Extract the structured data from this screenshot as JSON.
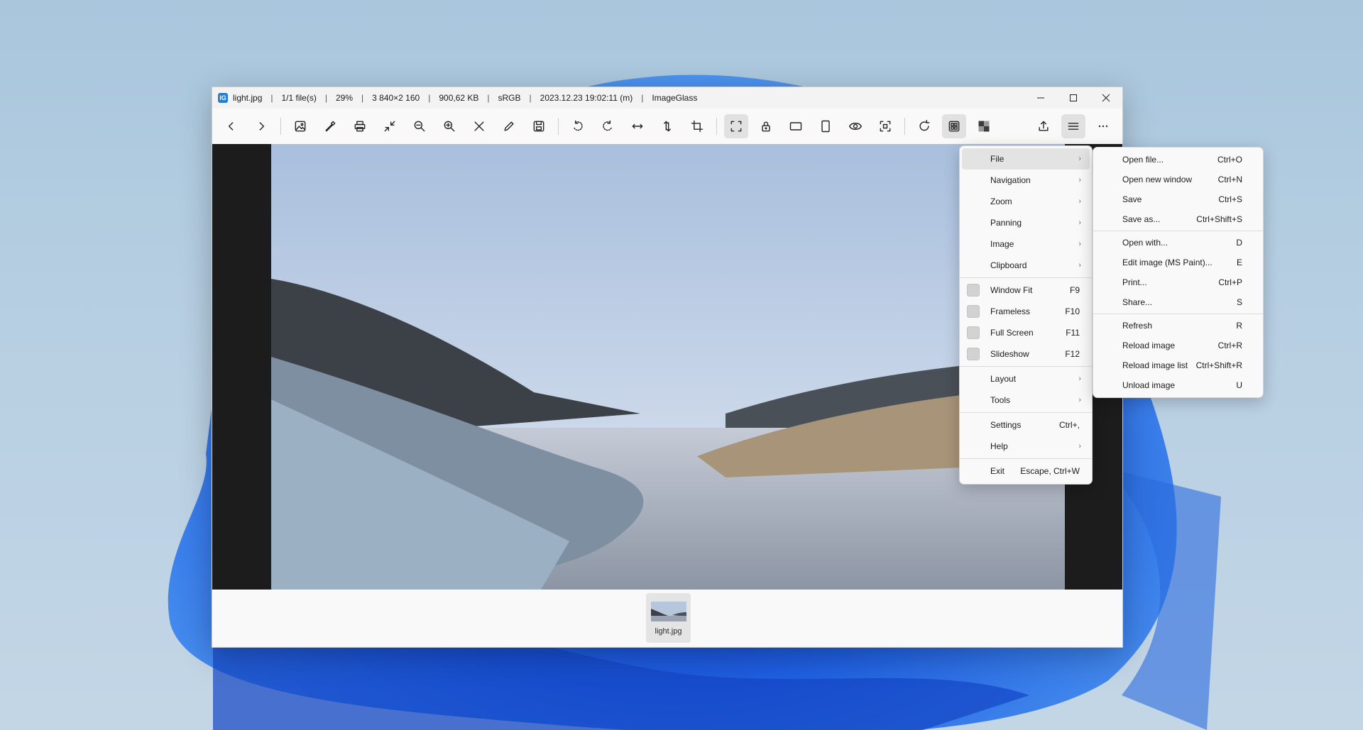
{
  "titlebar": {
    "filename": "light.jpg",
    "file_count": "1/1 file(s)",
    "zoom": "29%",
    "dimensions": "3 840×2 160",
    "filesize": "900,62 KB",
    "color_profile": "sRGB",
    "date": "2023.12.23 19:02:11 (m)",
    "app_name": "ImageGlass",
    "logo_letter": "IG"
  },
  "toolbar": {
    "buttons": [
      {
        "name": "previous-image",
        "icon": "chevron-left-icon"
      },
      {
        "name": "next-image",
        "icon": "chevron-right-icon"
      },
      {
        "name": "open-file",
        "icon": "image-icon"
      },
      {
        "name": "color-picker",
        "icon": "eyedropper-icon"
      },
      {
        "name": "print",
        "icon": "printer-icon"
      },
      {
        "name": "auto-zoom",
        "icon": "shrink-icon"
      },
      {
        "name": "zoom-out",
        "icon": "zoom-out-icon"
      },
      {
        "name": "zoom-in",
        "icon": "zoom-in-icon"
      },
      {
        "name": "clear",
        "icon": "close-icon"
      },
      {
        "name": "edit",
        "icon": "pencil-icon"
      },
      {
        "name": "save",
        "icon": "save-icon"
      },
      {
        "name": "rotate-left",
        "icon": "rotate-left-icon"
      },
      {
        "name": "rotate-right",
        "icon": "rotate-right-icon"
      },
      {
        "name": "flip-horizontal",
        "icon": "flip-horizontal-icon"
      },
      {
        "name": "flip-vertical",
        "icon": "flip-vertical-icon"
      },
      {
        "name": "crop",
        "icon": "crop-icon"
      },
      {
        "name": "window-fit",
        "icon": "window-fit-icon"
      },
      {
        "name": "lock-zoom",
        "icon": "lock-icon"
      },
      {
        "name": "scale-to-width",
        "icon": "landscape-icon"
      },
      {
        "name": "scale-to-height",
        "icon": "portrait-icon"
      },
      {
        "name": "preview",
        "icon": "eye-icon"
      },
      {
        "name": "full-screen",
        "icon": "fullscreen-icon"
      },
      {
        "name": "refresh",
        "icon": "refresh-icon"
      },
      {
        "name": "gallery",
        "icon": "gallery-icon"
      },
      {
        "name": "checkerboard",
        "icon": "checkerboard-icon"
      },
      {
        "name": "share",
        "icon": "upload-icon"
      },
      {
        "name": "main-menu",
        "icon": "hamburger-icon"
      },
      {
        "name": "more",
        "icon": "more-icon"
      }
    ]
  },
  "thumbnail": {
    "label": "light.jpg"
  },
  "main_menu": {
    "items": [
      {
        "label": "File",
        "submenu": true
      },
      {
        "label": "Navigation",
        "submenu": true
      },
      {
        "label": "Zoom",
        "submenu": true
      },
      {
        "label": "Panning",
        "submenu": true
      },
      {
        "label": "Image",
        "submenu": true
      },
      {
        "label": "Clipboard",
        "submenu": true
      },
      {
        "label": "Window Fit",
        "key": "F9"
      },
      {
        "label": "Frameless",
        "key": "F10"
      },
      {
        "label": "Full Screen",
        "key": "F11"
      },
      {
        "label": "Slideshow",
        "key": "F12"
      },
      {
        "label": "Layout",
        "submenu": true
      },
      {
        "label": "Tools",
        "submenu": true
      },
      {
        "label": "Settings",
        "key": "Ctrl+,"
      },
      {
        "label": "Help",
        "submenu": true
      },
      {
        "label": "Exit",
        "key": "Escape, Ctrl+W"
      }
    ],
    "arrow": "›"
  },
  "file_submenu": {
    "items": [
      {
        "label": "Open file...",
        "key": "Ctrl+O"
      },
      {
        "label": "Open new window",
        "key": "Ctrl+N"
      },
      {
        "label": "Save",
        "key": "Ctrl+S"
      },
      {
        "label": "Save as...",
        "key": "Ctrl+Shift+S"
      },
      {
        "label": "Open with...",
        "key": "D"
      },
      {
        "label": "Edit image (MS Paint)...",
        "key": "E"
      },
      {
        "label": "Print...",
        "key": "Ctrl+P"
      },
      {
        "label": "Share...",
        "key": "S"
      },
      {
        "label": "Refresh",
        "key": "R"
      },
      {
        "label": "Reload image",
        "key": "Ctrl+R"
      },
      {
        "label": "Reload image list",
        "key": "Ctrl+Shift+R"
      },
      {
        "label": "Unload image",
        "key": "U"
      }
    ]
  },
  "colors": {
    "accent": "#1f7fd8",
    "bloom": "#1a5ad6",
    "menu_highlight": "#e3e3e3"
  }
}
